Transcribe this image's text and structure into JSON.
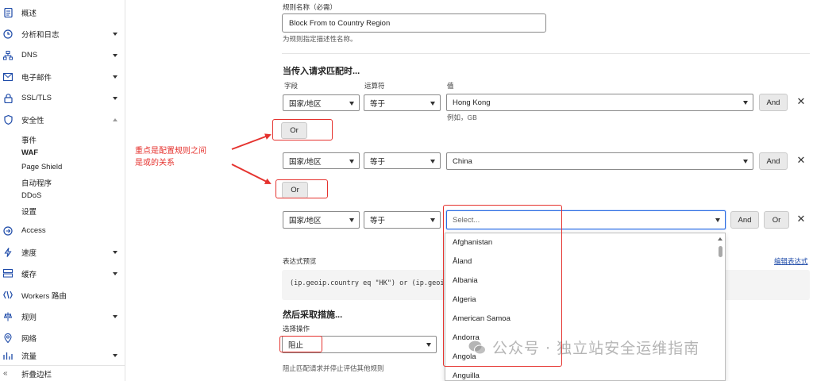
{
  "sidebar": {
    "items": [
      {
        "label": "概述",
        "icon": "document-icon"
      },
      {
        "label": "分析和日志",
        "icon": "clock-icon",
        "caret": true
      },
      {
        "label": "DNS",
        "icon": "network-icon",
        "caret": true
      },
      {
        "label": "电子邮件",
        "icon": "mail-icon",
        "caret": true
      },
      {
        "label": "SSL/TLS",
        "icon": "lock-icon",
        "caret": true
      },
      {
        "label": "安全性",
        "icon": "shield-icon",
        "caret": "up"
      }
    ],
    "security_sub": [
      "事件",
      "WAF",
      "Page Shield",
      "自动程序",
      "DDoS",
      "设置"
    ],
    "items2": [
      {
        "label": "Access",
        "icon": "access-icon"
      },
      {
        "label": "速度",
        "icon": "lightning-icon",
        "caret": true
      },
      {
        "label": "缓存",
        "icon": "cache-icon",
        "caret": true
      },
      {
        "label": "Workers 路由",
        "icon": "workers-icon"
      },
      {
        "label": "规则",
        "icon": "rules-icon",
        "caret": true
      },
      {
        "label": "网络",
        "icon": "location-icon"
      },
      {
        "label": "流量",
        "icon": "traffic-icon",
        "caret": true
      }
    ],
    "collapse_label": "折叠边栏"
  },
  "annotation": {
    "line1": "重点是配置规则之间",
    "line2": "是或的关系"
  },
  "form": {
    "rule_name_label": "规则名称（必需）",
    "rule_name_value": "Block From to Country Region",
    "rule_name_hint": "为规则指定描述性名称。",
    "when_heading": "当传入请求匹配时...",
    "col_field": "字段",
    "col_operator": "运算符",
    "col_value": "值",
    "rows": [
      {
        "field": "国家/地区",
        "operator": "等于",
        "value": "Hong Kong",
        "hint": "例如，GB"
      },
      {
        "field": "国家/地区",
        "operator": "等于",
        "value": "China"
      },
      {
        "field": "国家/地区",
        "operator": "等于",
        "placeholder": "Select..."
      }
    ],
    "and_label": "And",
    "or_label": "Or",
    "expression_preview_label": "表达式预览",
    "edit_expression_link": "编辑表达式",
    "expression_text": "(ip.geoip.country eq \"HK\") or (ip.geoip.country eq \"CN\") or (ip.geoip.country eq \"\")",
    "then_heading": "然后采取措施...",
    "action_label": "选择操作",
    "action_value": "阻止",
    "action_hint": "阻止匹配请求并停止评估其他规则"
  },
  "country_options": [
    "Afghanistan",
    "Åland",
    "Albania",
    "Algeria",
    "American Samoa",
    "Andorra",
    "Angola",
    "Anguilla"
  ],
  "watermark": "公众号 · 独立站安全运维指南",
  "colors": {
    "annotation_red": "#e5322e",
    "nav_icon_blue": "#1d4aa8",
    "focus_blue": "#2d6de0"
  }
}
